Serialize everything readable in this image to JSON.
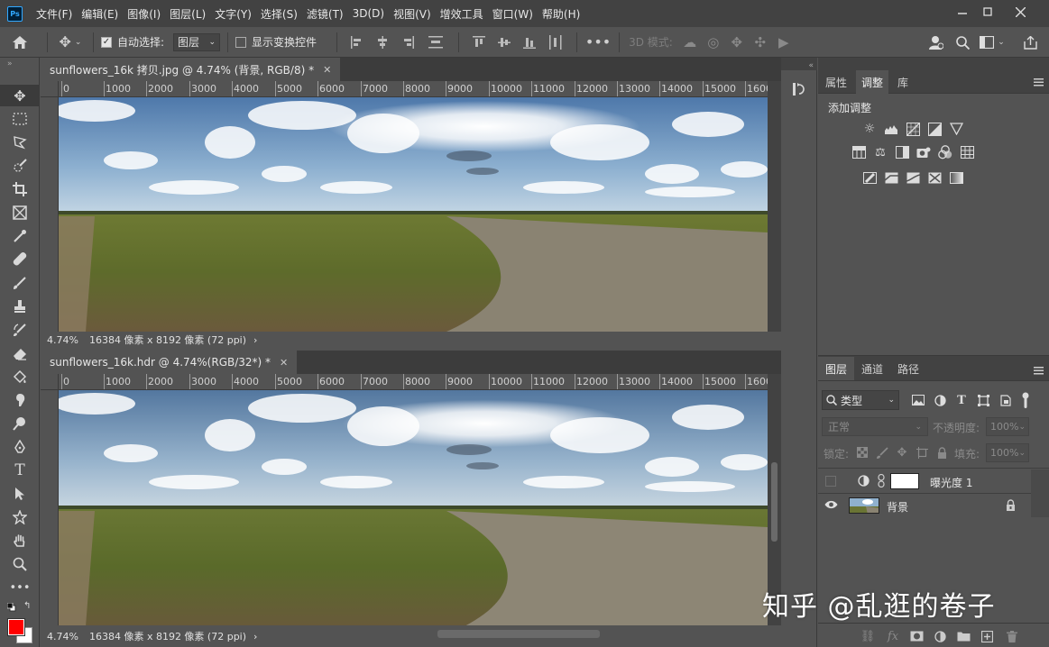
{
  "app": {
    "logo_text": "Ps"
  },
  "menu": [
    "文件(F)",
    "编辑(E)",
    "图像(I)",
    "图层(L)",
    "文字(Y)",
    "选择(S)",
    "滤镜(T)",
    "3D(D)",
    "视图(V)",
    "增效工具",
    "窗口(W)",
    "帮助(H)"
  ],
  "options_bar": {
    "auto_select_label": "自动选择:",
    "auto_select_checked": true,
    "auto_select_target": "图层",
    "show_transform_label": "显示变换控件",
    "show_transform_checked": false,
    "mode_3d_label": "3D 模式:"
  },
  "documents": [
    {
      "tab_title": "sunflowers_16k 拷贝.jpg @ 4.74% (背景, RGB/8) *",
      "ruler": [
        "0",
        "1000",
        "2000",
        "3000",
        "4000",
        "5000",
        "6000",
        "7000",
        "8000",
        "9000",
        "10000",
        "11000",
        "12000",
        "13000",
        "14000",
        "15000",
        "1600"
      ],
      "zoom": "4.74%",
      "size_info": "16384 像素 x 8192 像素 (72 ppi)"
    },
    {
      "tab_title": "sunflowers_16k.hdr @ 4.74%(RGB/32*) *",
      "ruler": [
        "0",
        "1000",
        "2000",
        "3000",
        "4000",
        "5000",
        "6000",
        "7000",
        "8000",
        "9000",
        "10000",
        "11000",
        "12000",
        "13000",
        "14000",
        "15000",
        "1600"
      ],
      "zoom": "4.74%",
      "size_info": "16384 像素 x 8192 像素 (72 ppi)"
    }
  ],
  "adjust_panel": {
    "tabs": [
      "属性",
      "调整",
      "库"
    ],
    "active_tab": "调整",
    "title": "添加调整"
  },
  "layers_panel": {
    "tabs": [
      "图层",
      "通道",
      "路径"
    ],
    "active_tab": "图层",
    "filter_kind": "类型",
    "blend_mode": "正常",
    "opacity_label": "不透明度:",
    "opacity_value": "100%",
    "lock_label": "锁定:",
    "fill_label": "填充:",
    "fill_value": "100%",
    "layers": [
      {
        "name": "曝光度 1",
        "visible": false
      },
      {
        "name": "背景",
        "visible": true
      }
    ]
  },
  "colors": {
    "foreground": "#ff0000",
    "background": "#ffffff"
  },
  "watermark": "知乎 @乱逛的卷子"
}
